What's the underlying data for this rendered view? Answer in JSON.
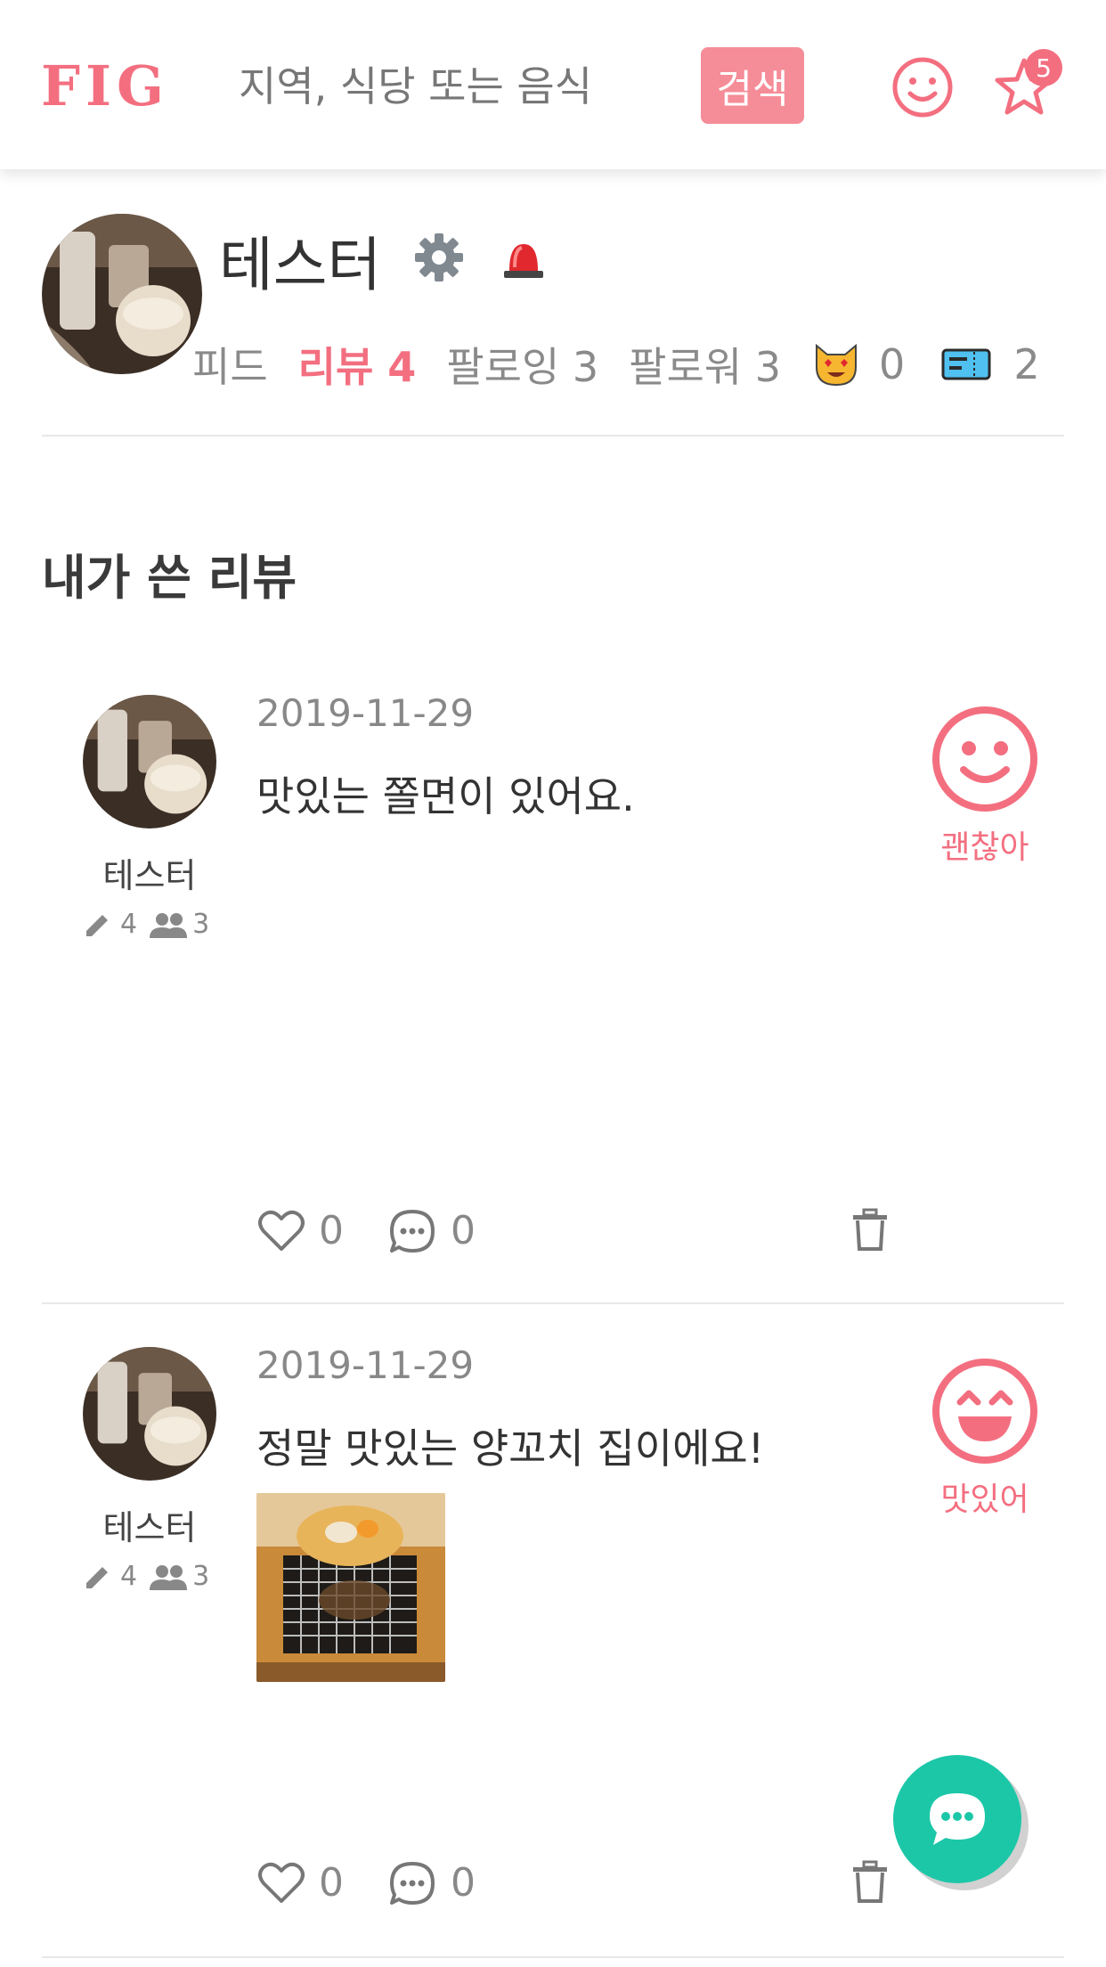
{
  "header": {
    "logo": "FIG",
    "search_placeholder": "지역, 식당 또는 음식",
    "search_button": "검색",
    "notification_count": "5"
  },
  "profile": {
    "name": "테스터",
    "stats": {
      "feed_label": "피드",
      "review_label": "리뷰 4",
      "following_label": "팔로잉 3",
      "follower_label": "팔로워 3",
      "cat_count": "0",
      "ticket_count": "2"
    }
  },
  "section_title": "내가 쓴 리뷰",
  "reviews": [
    {
      "author": "테스터",
      "posts": "4",
      "follows": "3",
      "date": "2019-11-29",
      "text": "맛있는 쫄면이 있어요.",
      "rating_label": "괜찮아",
      "likes": "0",
      "comments": "0"
    },
    {
      "author": "테스터",
      "posts": "4",
      "follows": "3",
      "date": "2019-11-29",
      "text": "정말 맛있는 양꼬치 집이에요!",
      "rating_label": "맛있어",
      "likes": "0",
      "comments": "0"
    }
  ],
  "colors": {
    "brand": "#f36f80",
    "search_button": "#f58d98",
    "fab": "#1cc7a8"
  }
}
